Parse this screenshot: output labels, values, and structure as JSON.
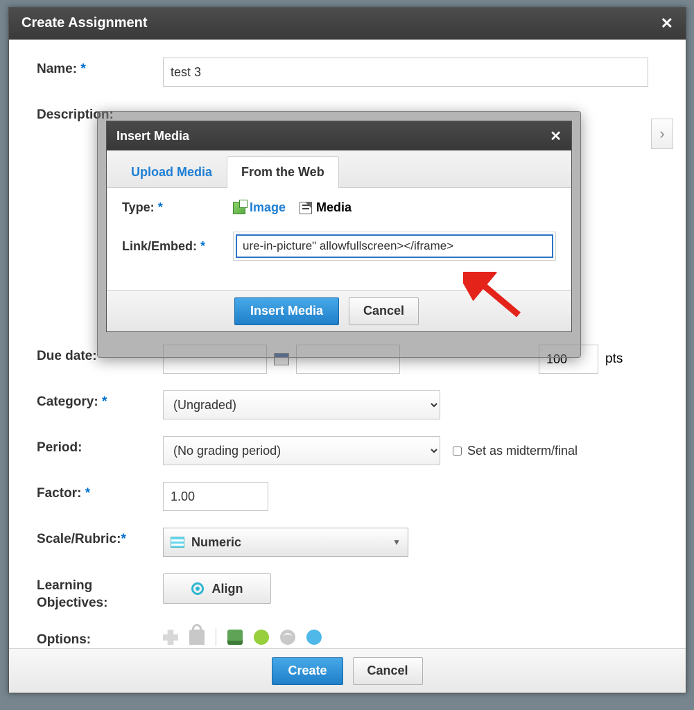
{
  "outer": {
    "title": "Create Assignment",
    "name_label": "Name:",
    "name_value": "test 3",
    "description_label": "Description:",
    "due_label": "Due date:",
    "pts_value": "100",
    "pts_label": "pts",
    "category_label": "Category:",
    "category_value": "(Ungraded)",
    "period_label": "Period:",
    "period_value": "(No grading period)",
    "midterm_label": "Set as midterm/final",
    "factor_label": "Factor:",
    "factor_value": "1.00",
    "scale_label": "Scale/Rubric:",
    "scale_value": "Numeric",
    "learning_label_1": "Learning",
    "learning_label_2": "Objectives:",
    "align_label": "Align",
    "options_label": "Options:",
    "create_btn": "Create",
    "cancel_btn": "Cancel"
  },
  "modal": {
    "title": "Insert Media",
    "tab_upload": "Upload Media",
    "tab_web": "From the Web",
    "type_label": "Type:",
    "type_image": "Image",
    "type_media": "Media",
    "link_label": "Link/Embed:",
    "link_value": "ure-in-picture\" allowfullscreen></iframe>",
    "insert_btn": "Insert Media",
    "cancel_btn": "Cancel"
  }
}
